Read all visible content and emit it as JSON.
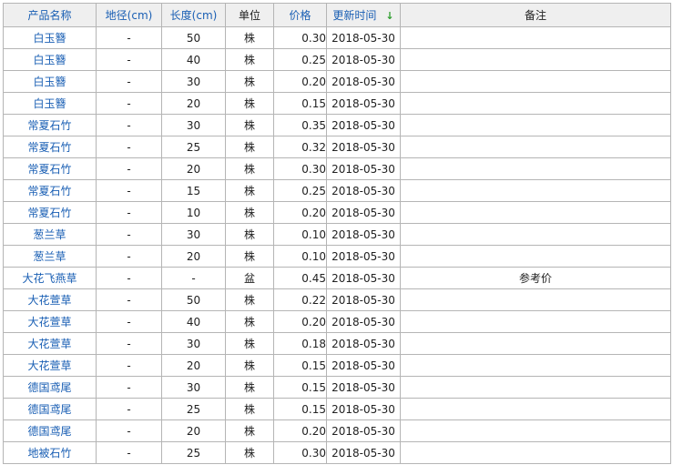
{
  "headers": {
    "name": "产品名称",
    "diameter": "地径(cm)",
    "length": "长度(cm)",
    "unit": "单位",
    "price": "价格",
    "updated": "更新时间",
    "sort_arrow": "↓",
    "note": "备注"
  },
  "colors": {
    "link": "#1a5fb4",
    "header_bg": "#efefef",
    "sort_arrow": "#2e9e2e",
    "border": "#b5b5b5"
  },
  "rows": [
    {
      "name": "白玉簪",
      "diameter": "-",
      "length": "50",
      "unit": "株",
      "price": "0.30",
      "updated": "2018-05-30",
      "note": ""
    },
    {
      "name": "白玉簪",
      "diameter": "-",
      "length": "40",
      "unit": "株",
      "price": "0.25",
      "updated": "2018-05-30",
      "note": ""
    },
    {
      "name": "白玉簪",
      "diameter": "-",
      "length": "30",
      "unit": "株",
      "price": "0.20",
      "updated": "2018-05-30",
      "note": ""
    },
    {
      "name": "白玉簪",
      "diameter": "-",
      "length": "20",
      "unit": "株",
      "price": "0.15",
      "updated": "2018-05-30",
      "note": ""
    },
    {
      "name": "常夏石竹",
      "diameter": "-",
      "length": "30",
      "unit": "株",
      "price": "0.35",
      "updated": "2018-05-30",
      "note": ""
    },
    {
      "name": "常夏石竹",
      "diameter": "-",
      "length": "25",
      "unit": "株",
      "price": "0.32",
      "updated": "2018-05-30",
      "note": ""
    },
    {
      "name": "常夏石竹",
      "diameter": "-",
      "length": "20",
      "unit": "株",
      "price": "0.30",
      "updated": "2018-05-30",
      "note": ""
    },
    {
      "name": "常夏石竹",
      "diameter": "-",
      "length": "15",
      "unit": "株",
      "price": "0.25",
      "updated": "2018-05-30",
      "note": ""
    },
    {
      "name": "常夏石竹",
      "diameter": "-",
      "length": "10",
      "unit": "株",
      "price": "0.20",
      "updated": "2018-05-30",
      "note": ""
    },
    {
      "name": "葱兰草",
      "diameter": "-",
      "length": "30",
      "unit": "株",
      "price": "0.10",
      "updated": "2018-05-30",
      "note": ""
    },
    {
      "name": "葱兰草",
      "diameter": "-",
      "length": "20",
      "unit": "株",
      "price": "0.10",
      "updated": "2018-05-30",
      "note": ""
    },
    {
      "name": "大花飞燕草",
      "diameter": "-",
      "length": "-",
      "unit": "盆",
      "price": "0.45",
      "updated": "2018-05-30",
      "note": "参考价"
    },
    {
      "name": "大花萱草",
      "diameter": "-",
      "length": "50",
      "unit": "株",
      "price": "0.22",
      "updated": "2018-05-30",
      "note": ""
    },
    {
      "name": "大花萱草",
      "diameter": "-",
      "length": "40",
      "unit": "株",
      "price": "0.20",
      "updated": "2018-05-30",
      "note": ""
    },
    {
      "name": "大花萱草",
      "diameter": "-",
      "length": "30",
      "unit": "株",
      "price": "0.18",
      "updated": "2018-05-30",
      "note": ""
    },
    {
      "name": "大花萱草",
      "diameter": "-",
      "length": "20",
      "unit": "株",
      "price": "0.15",
      "updated": "2018-05-30",
      "note": ""
    },
    {
      "name": "德国鸢尾",
      "diameter": "-",
      "length": "30",
      "unit": "株",
      "price": "0.15",
      "updated": "2018-05-30",
      "note": ""
    },
    {
      "name": "德国鸢尾",
      "diameter": "-",
      "length": "25",
      "unit": "株",
      "price": "0.15",
      "updated": "2018-05-30",
      "note": ""
    },
    {
      "name": "德国鸢尾",
      "diameter": "-",
      "length": "20",
      "unit": "株",
      "price": "0.20",
      "updated": "2018-05-30",
      "note": ""
    },
    {
      "name": "地被石竹",
      "diameter": "-",
      "length": "25",
      "unit": "株",
      "price": "0.30",
      "updated": "2018-05-30",
      "note": ""
    }
  ]
}
